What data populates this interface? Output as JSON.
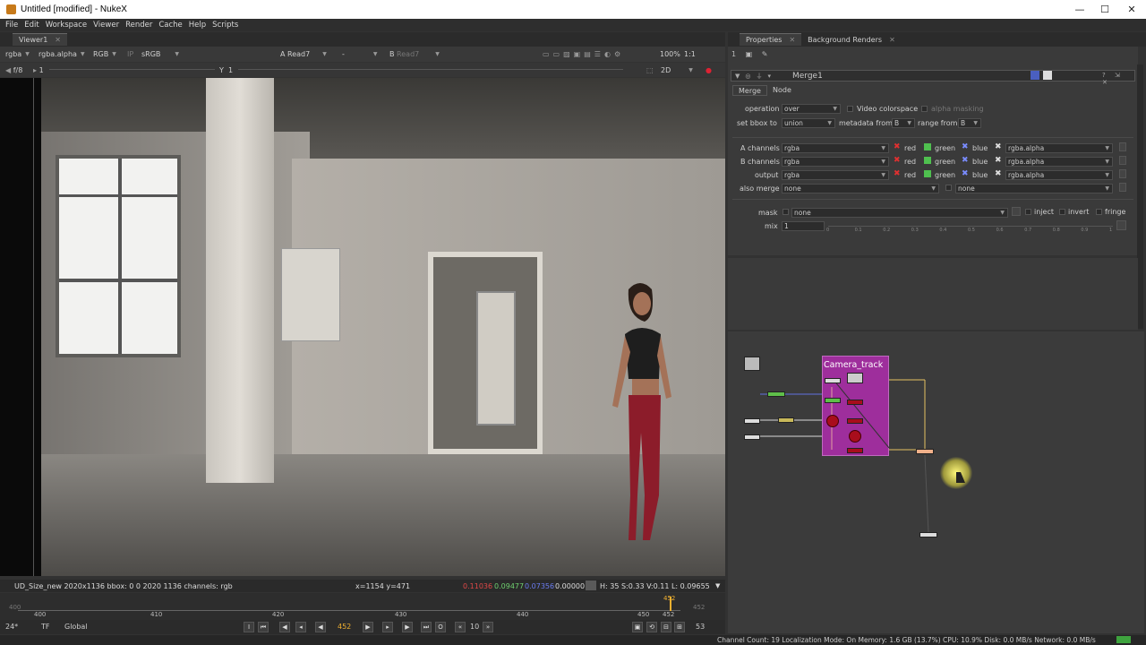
{
  "window": {
    "title": "Untitled [modified] - NukeX",
    "min": "—",
    "max": "☐",
    "close": "✕"
  },
  "menu": [
    "File",
    "Edit",
    "Workspace",
    "Viewer",
    "Render",
    "Cache",
    "Help",
    "Scripts"
  ],
  "viewer_tab": "Viewer1",
  "viewer_toolbar": {
    "channel": "rgba",
    "alpha": "rgba.alpha",
    "colorspace_mode": "RGB",
    "ip": "IP",
    "lut": "sRGB",
    "a_input": "Read7",
    "a_label": "A",
    "op": "-",
    "b_label": "B",
    "b_input": "Read7",
    "zoom": "100%",
    "ratio": "1:1"
  },
  "viewer_toolbar2": {
    "fstop": "f/8",
    "frame_prefix": "1",
    "y_label": "Y",
    "y_value": "1",
    "mode": "2D"
  },
  "viewer_status": {
    "info": "UD_Size_new 2020x1136  bbox: 0 0 2020 1136 channels: rgb",
    "coords": "x=1154 y=471",
    "r": "0.11036",
    "g": "0.09477",
    "b": "0.07356",
    "a": "0.00000",
    "hsvl": "H: 35 S:0.33 V:0.11  L: 0.09655"
  },
  "timeline": {
    "start": "400",
    "end": "452",
    "labels": [
      "400",
      "410",
      "420",
      "430",
      "440",
      "450",
      "452"
    ],
    "current_marker": "452"
  },
  "playback": {
    "fps": "24*",
    "tf": "TF",
    "scope": "Global",
    "frame": "452",
    "step": "10",
    "end_frame": "53"
  },
  "statusbar": "Channel Count: 19  Localization Mode: On  Memory: 1.6 GB (13.7%)  CPU: 10.9%  Disk: 0.0 MB/s  Network: 0.0 MB/s",
  "right_tabs": [
    "Properties",
    "Background Renders"
  ],
  "properties": {
    "node_name": "Merge1",
    "subtabs": [
      "Merge",
      "Node"
    ],
    "operation_label": "operation",
    "operation": "over",
    "video_colorspace": "Video colorspace",
    "alpha_masking": "alpha masking",
    "bbox_label": "set bbox to",
    "bbox": "union",
    "metadata_label": "metadata from",
    "metadata": "B",
    "range_label": "range from",
    "range": "B",
    "a_channels_label": "A channels",
    "a_channels": "rgba",
    "b_channels_label": "B channels",
    "b_channels": "rgba",
    "output_label": "output",
    "output": "rgba",
    "also_merge_label": "also merge",
    "also_merge": "none",
    "also_merge2": "none",
    "red": "red",
    "green": "green",
    "blue": "blue",
    "alpha_ch": "rgba.alpha",
    "mask_label": "mask",
    "mask": "none",
    "inject": "inject",
    "invert": "invert",
    "fringe": "fringe",
    "mix_label": "mix",
    "mix": "1",
    "mix_ticks": [
      "0",
      "0.1",
      "0.2",
      "0.3",
      "0.4",
      "0.5",
      "0.6",
      "0.7",
      "0.8",
      "0.9",
      "1"
    ]
  },
  "dag": {
    "backdrop_label": "Camera_track"
  },
  "colors": {
    "backdrop": "#9e2e9c",
    "accent": "#f0b030",
    "red_node": "#a80d1c",
    "green_node": "#5fbf4a"
  }
}
